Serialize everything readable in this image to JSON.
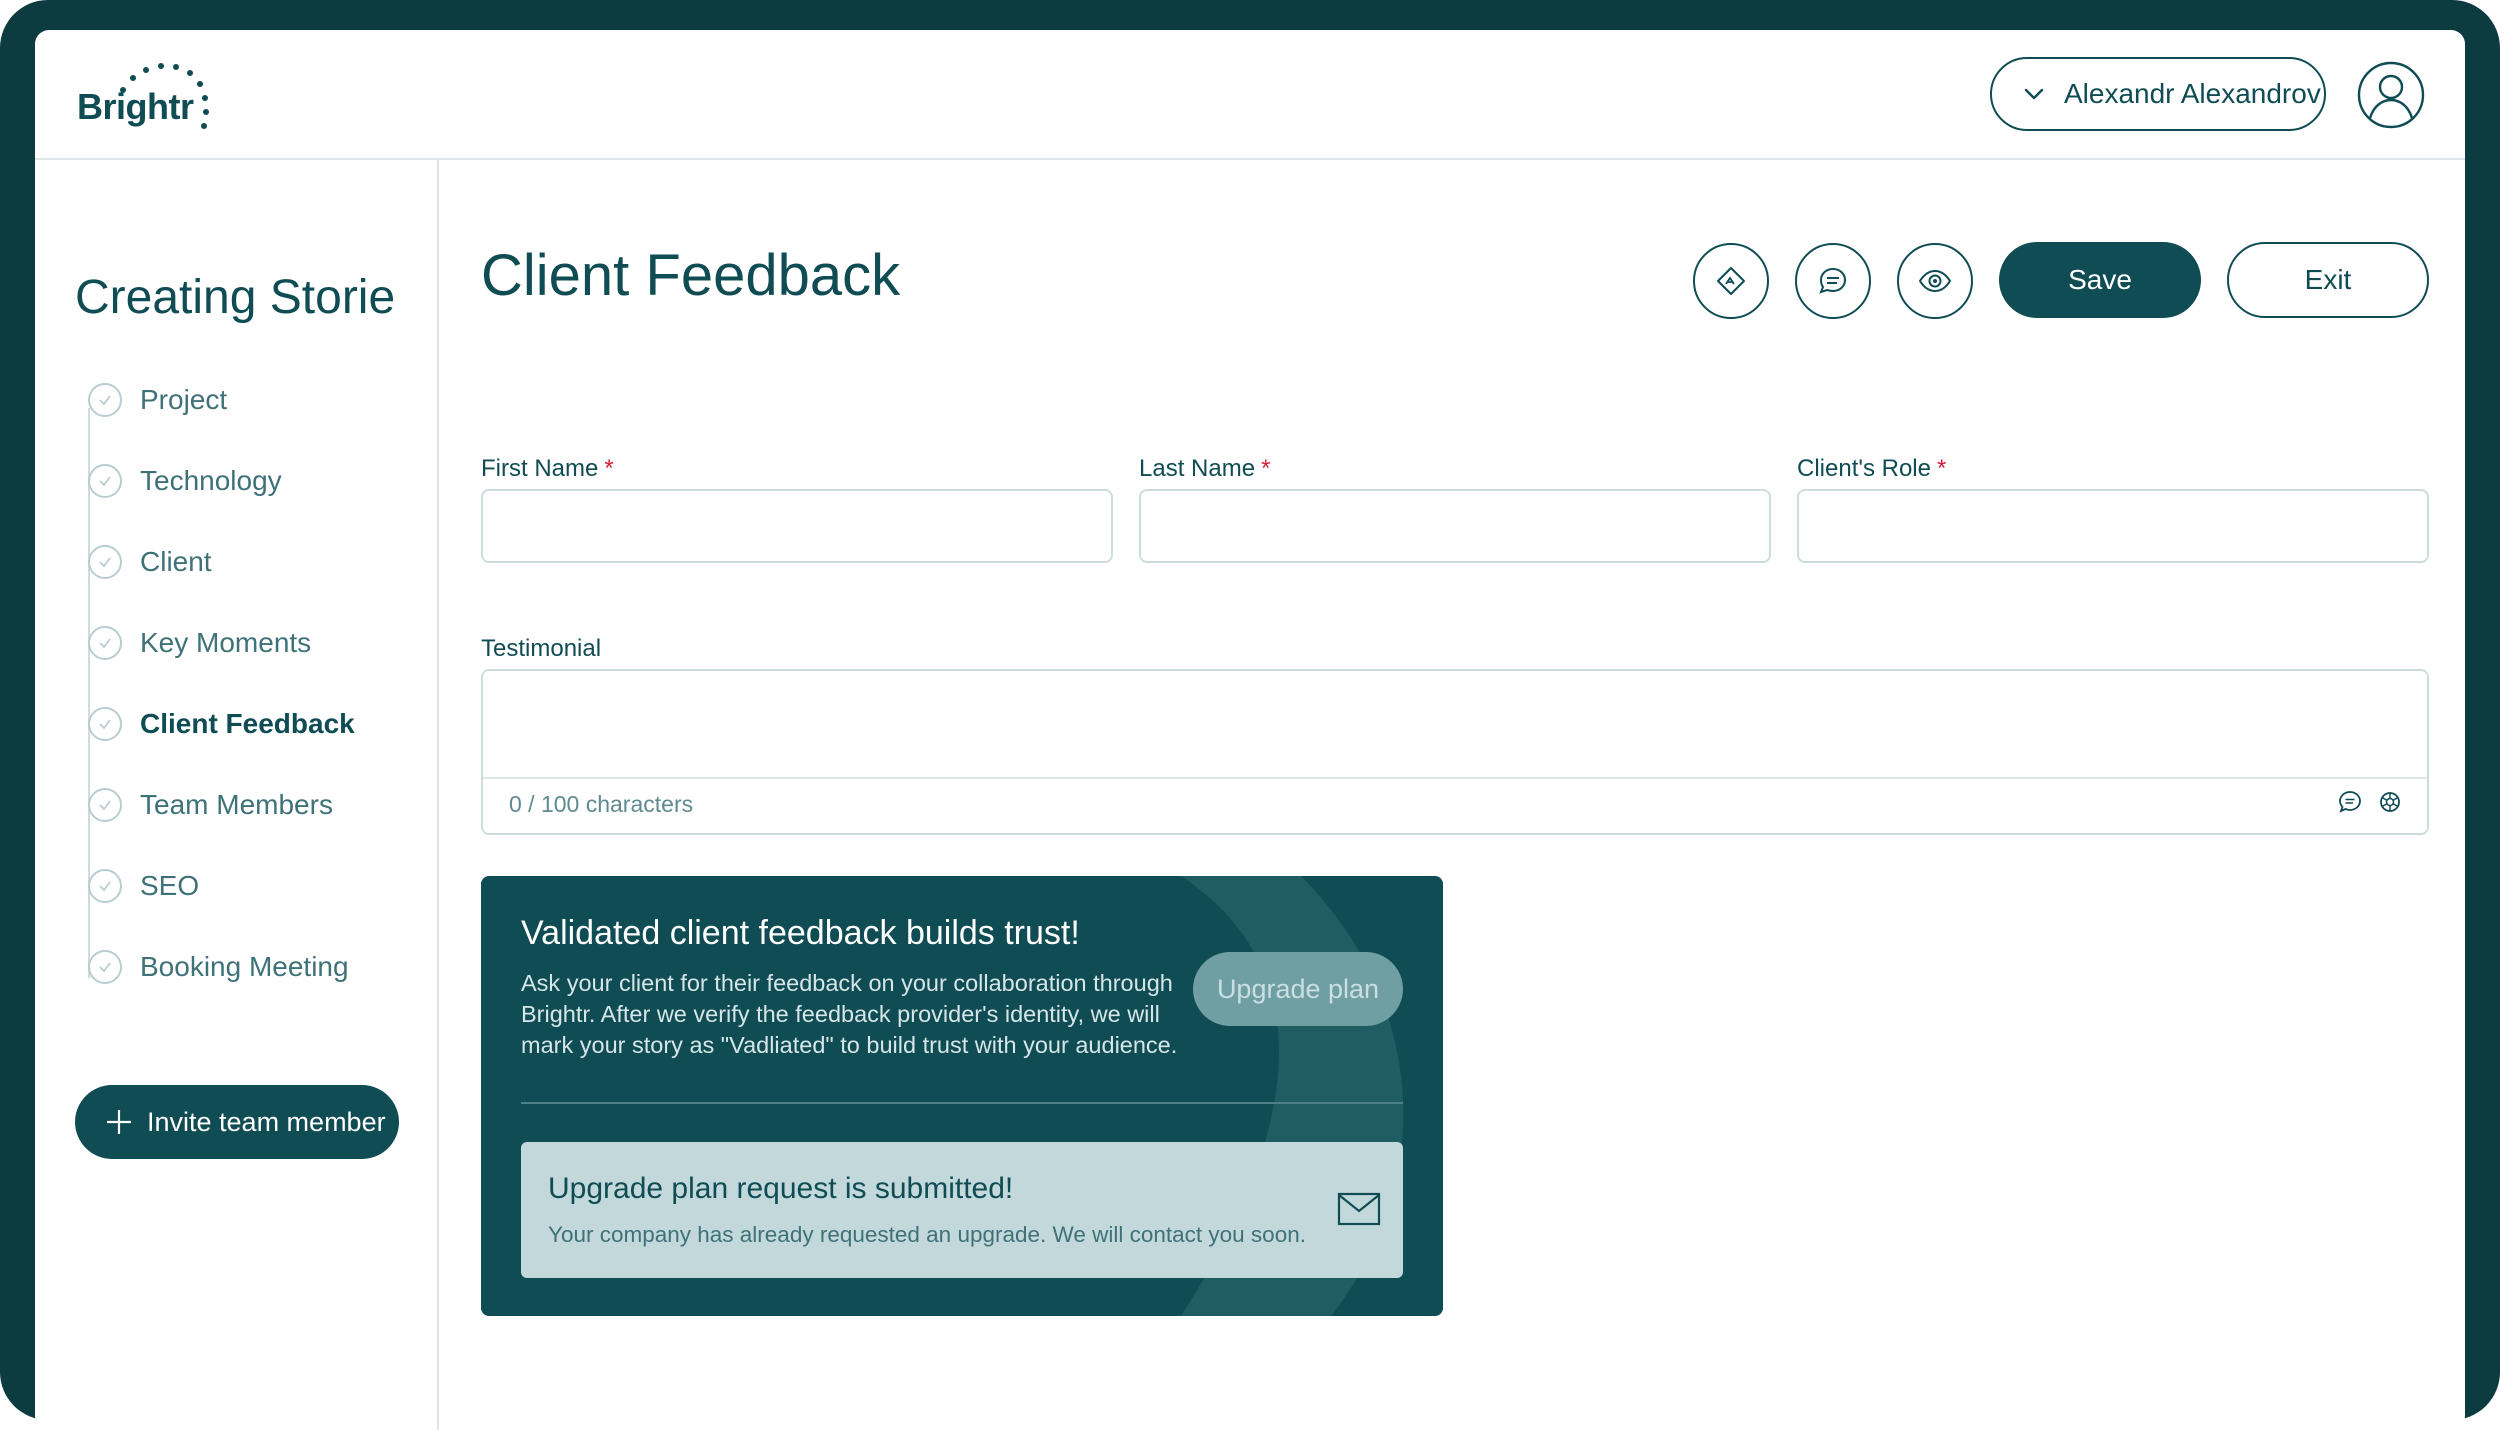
{
  "brand": {
    "name": "Brightr"
  },
  "header": {
    "user_name": "Alexandr Alexandrov"
  },
  "sidebar": {
    "title": "Creating Storie",
    "steps": [
      {
        "label": "Project"
      },
      {
        "label": "Technology"
      },
      {
        "label": "Client"
      },
      {
        "label": "Key Moments"
      },
      {
        "label": "Client Feedback",
        "active": true
      },
      {
        "label": "Team Members"
      },
      {
        "label": "SEO"
      },
      {
        "label": "Booking Meeting"
      }
    ],
    "invite_label": "Invite team member"
  },
  "main": {
    "title": "Client Feedback",
    "toolbar": {
      "icons": [
        "ai-sparkle-icon",
        "comment-icon",
        "eye-icon"
      ],
      "save_label": "Save",
      "exit_label": "Exit"
    },
    "fields": {
      "first_name": {
        "label": "First Name",
        "required_mark": "*",
        "value": ""
      },
      "last_name": {
        "label": "Last Name",
        "required_mark": "*",
        "value": ""
      },
      "client_role": {
        "label": "Client's Role",
        "required_mark": "*",
        "value": ""
      },
      "testimonial": {
        "label": "Testimonial",
        "value": "",
        "char_count": "0 / 100 characters"
      }
    },
    "promo": {
      "title": "Validated client feedback builds trust!",
      "body": "Ask your client for their feedback on your collaboration through Brightr. After we verify the feedback provider's identity, we will mark your story as \"Vadliated\" to build trust with your audience.",
      "upgrade_label": "Upgrade plan",
      "notice": {
        "title": "Upgrade plan request is submitted!",
        "body": "Your company has already requested an upgrade. We will contact you soon."
      }
    }
  },
  "colors": {
    "primary": "#0f4c53",
    "required": "#d3203c",
    "notice_bg": "#c2d8da",
    "border": "#cfdcdd"
  }
}
